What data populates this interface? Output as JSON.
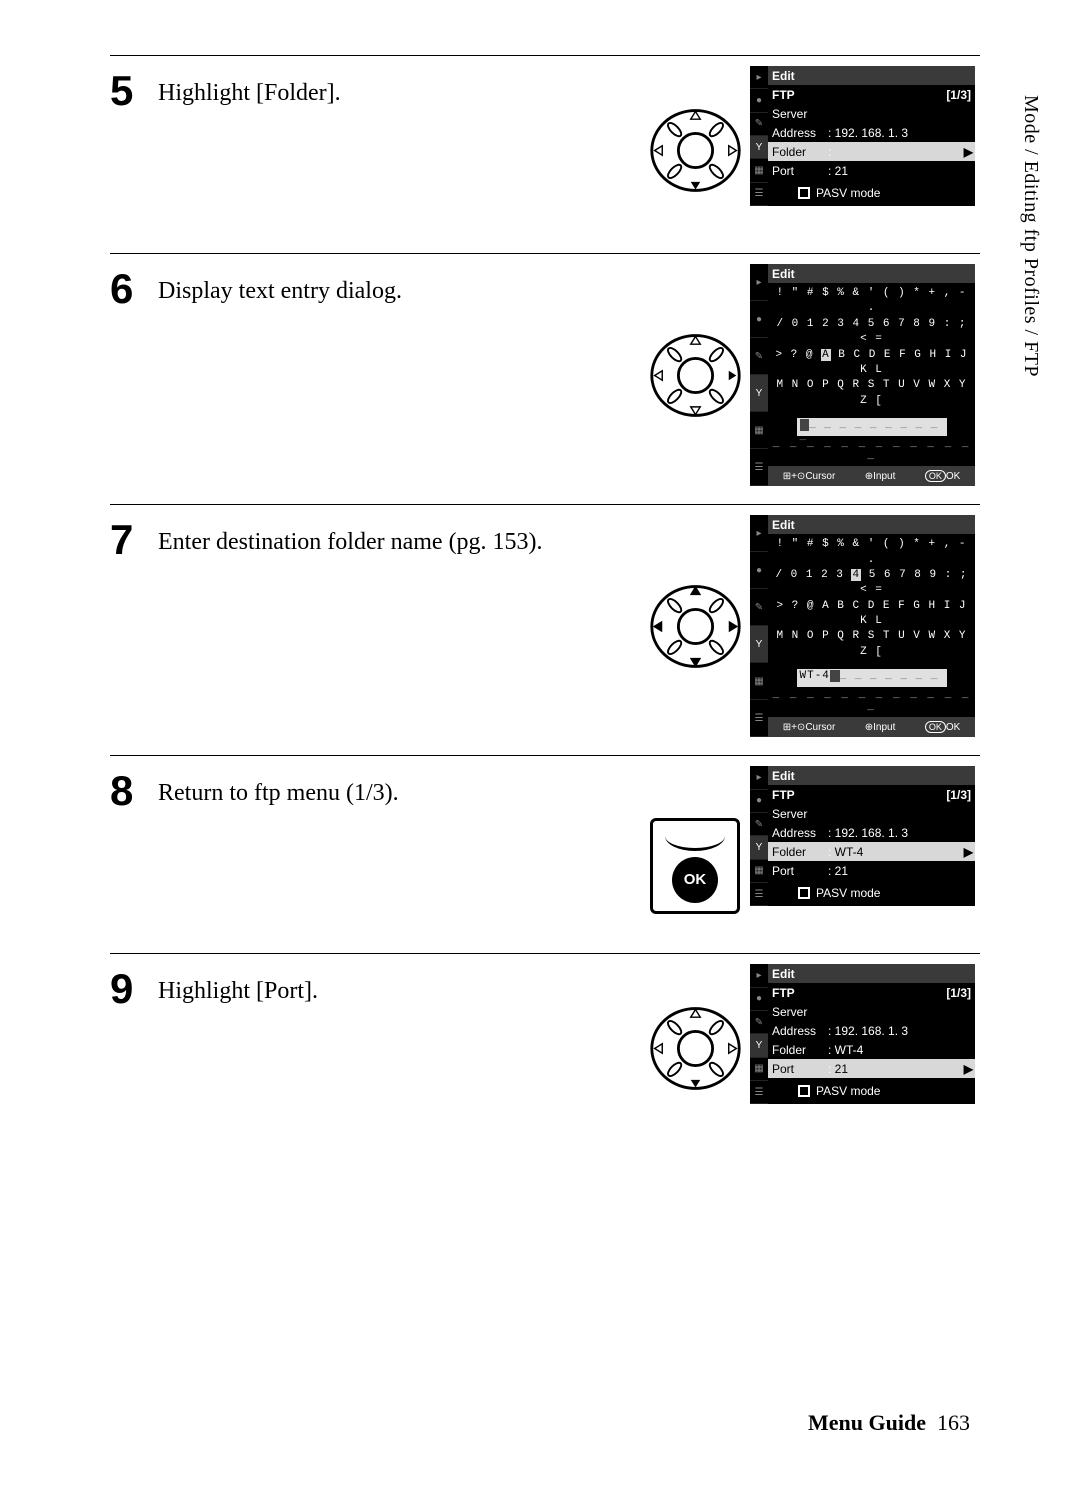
{
  "side_text": "Mode / Editing ftp Profiles / FTP",
  "footer": {
    "guide": "Menu Guide",
    "page": "163"
  },
  "steps": {
    "s5": {
      "num": "5",
      "text": "Highlight [Folder].",
      "dpad_highlight": "down"
    },
    "s6": {
      "num": "6",
      "text": "Display text entry dialog.",
      "dpad_highlight": "right"
    },
    "s7": {
      "num": "7",
      "text": "Enter destination folder name (pg. 153).",
      "dpad_highlight": "all"
    },
    "s8": {
      "num": "8",
      "text": "Return to ftp menu (1/3).",
      "control": "ok",
      "ok_label": "OK"
    },
    "s9": {
      "num": "9",
      "text": "Highlight [Port].",
      "dpad_highlight": "down"
    }
  },
  "lcd": {
    "edit_title": "Edit",
    "ftp_bar": "FTP",
    "pager": "[1/3]",
    "server_label": "Server",
    "address_label": "Address",
    "address_value": "192. 168. 1. 3",
    "folder_label": "Folder",
    "folder_value_wt4": "WT-4",
    "port_label": "Port",
    "port_value": "21",
    "pasv_label": "PASV mode",
    "kbd_row1": "! \" # $ % & ' ( ) * + , - .",
    "kbd_row2_pre": "/ 0 1 2 3 ",
    "kbd_row2_hl_4": "4",
    "kbd_row2_post_4": " 5 6 7 8 9 : ; < =",
    "kbd_row2_full": "/ 0 1 2 3 4 5 6 7 8 9 : ; < =",
    "kbd_row3_pre": "> ? @ ",
    "kbd_row3_hl_A": "A",
    "kbd_row3_post_A": " B C D E F G H I J K L",
    "kbd_row3_full": "> ? @ A B C D E F G H I J K L",
    "kbd_row4": "M N O P Q R S T U V W X Y Z [",
    "input_wt4": "WT-4",
    "dashline": "_ _ _ _ _ _ _ _ _ _ _ _ _",
    "status_cursor": "Cursor",
    "status_input": "Input",
    "status_ok": "OK",
    "status_okbtn": "OK"
  }
}
